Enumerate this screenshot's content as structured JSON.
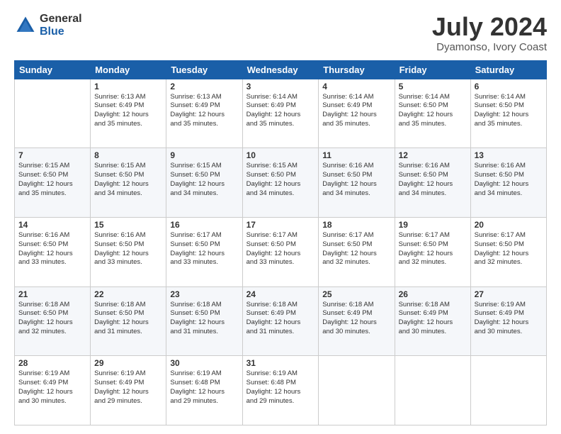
{
  "logo": {
    "general": "General",
    "blue": "Blue"
  },
  "header": {
    "title": "July 2024",
    "subtitle": "Dyamonso, Ivory Coast"
  },
  "weekdays": [
    "Sunday",
    "Monday",
    "Tuesday",
    "Wednesday",
    "Thursday",
    "Friday",
    "Saturday"
  ],
  "weeks": [
    [
      {
        "day": "",
        "detail": ""
      },
      {
        "day": "1",
        "detail": "Sunrise: 6:13 AM\nSunset: 6:49 PM\nDaylight: 12 hours\nand 35 minutes."
      },
      {
        "day": "2",
        "detail": "Sunrise: 6:13 AM\nSunset: 6:49 PM\nDaylight: 12 hours\nand 35 minutes."
      },
      {
        "day": "3",
        "detail": "Sunrise: 6:14 AM\nSunset: 6:49 PM\nDaylight: 12 hours\nand 35 minutes."
      },
      {
        "day": "4",
        "detail": "Sunrise: 6:14 AM\nSunset: 6:49 PM\nDaylight: 12 hours\nand 35 minutes."
      },
      {
        "day": "5",
        "detail": "Sunrise: 6:14 AM\nSunset: 6:50 PM\nDaylight: 12 hours\nand 35 minutes."
      },
      {
        "day": "6",
        "detail": "Sunrise: 6:14 AM\nSunset: 6:50 PM\nDaylight: 12 hours\nand 35 minutes."
      }
    ],
    [
      {
        "day": "7",
        "detail": "Sunrise: 6:15 AM\nSunset: 6:50 PM\nDaylight: 12 hours\nand 35 minutes."
      },
      {
        "day": "8",
        "detail": "Sunrise: 6:15 AM\nSunset: 6:50 PM\nDaylight: 12 hours\nand 34 minutes."
      },
      {
        "day": "9",
        "detail": "Sunrise: 6:15 AM\nSunset: 6:50 PM\nDaylight: 12 hours\nand 34 minutes."
      },
      {
        "day": "10",
        "detail": "Sunrise: 6:15 AM\nSunset: 6:50 PM\nDaylight: 12 hours\nand 34 minutes."
      },
      {
        "day": "11",
        "detail": "Sunrise: 6:16 AM\nSunset: 6:50 PM\nDaylight: 12 hours\nand 34 minutes."
      },
      {
        "day": "12",
        "detail": "Sunrise: 6:16 AM\nSunset: 6:50 PM\nDaylight: 12 hours\nand 34 minutes."
      },
      {
        "day": "13",
        "detail": "Sunrise: 6:16 AM\nSunset: 6:50 PM\nDaylight: 12 hours\nand 34 minutes."
      }
    ],
    [
      {
        "day": "14",
        "detail": "Sunrise: 6:16 AM\nSunset: 6:50 PM\nDaylight: 12 hours\nand 33 minutes."
      },
      {
        "day": "15",
        "detail": "Sunrise: 6:16 AM\nSunset: 6:50 PM\nDaylight: 12 hours\nand 33 minutes."
      },
      {
        "day": "16",
        "detail": "Sunrise: 6:17 AM\nSunset: 6:50 PM\nDaylight: 12 hours\nand 33 minutes."
      },
      {
        "day": "17",
        "detail": "Sunrise: 6:17 AM\nSunset: 6:50 PM\nDaylight: 12 hours\nand 33 minutes."
      },
      {
        "day": "18",
        "detail": "Sunrise: 6:17 AM\nSunset: 6:50 PM\nDaylight: 12 hours\nand 32 minutes."
      },
      {
        "day": "19",
        "detail": "Sunrise: 6:17 AM\nSunset: 6:50 PM\nDaylight: 12 hours\nand 32 minutes."
      },
      {
        "day": "20",
        "detail": "Sunrise: 6:17 AM\nSunset: 6:50 PM\nDaylight: 12 hours\nand 32 minutes."
      }
    ],
    [
      {
        "day": "21",
        "detail": "Sunrise: 6:18 AM\nSunset: 6:50 PM\nDaylight: 12 hours\nand 32 minutes."
      },
      {
        "day": "22",
        "detail": "Sunrise: 6:18 AM\nSunset: 6:50 PM\nDaylight: 12 hours\nand 31 minutes."
      },
      {
        "day": "23",
        "detail": "Sunrise: 6:18 AM\nSunset: 6:50 PM\nDaylight: 12 hours\nand 31 minutes."
      },
      {
        "day": "24",
        "detail": "Sunrise: 6:18 AM\nSunset: 6:49 PM\nDaylight: 12 hours\nand 31 minutes."
      },
      {
        "day": "25",
        "detail": "Sunrise: 6:18 AM\nSunset: 6:49 PM\nDaylight: 12 hours\nand 30 minutes."
      },
      {
        "day": "26",
        "detail": "Sunrise: 6:18 AM\nSunset: 6:49 PM\nDaylight: 12 hours\nand 30 minutes."
      },
      {
        "day": "27",
        "detail": "Sunrise: 6:19 AM\nSunset: 6:49 PM\nDaylight: 12 hours\nand 30 minutes."
      }
    ],
    [
      {
        "day": "28",
        "detail": "Sunrise: 6:19 AM\nSunset: 6:49 PM\nDaylight: 12 hours\nand 30 minutes."
      },
      {
        "day": "29",
        "detail": "Sunrise: 6:19 AM\nSunset: 6:49 PM\nDaylight: 12 hours\nand 29 minutes."
      },
      {
        "day": "30",
        "detail": "Sunrise: 6:19 AM\nSunset: 6:48 PM\nDaylight: 12 hours\nand 29 minutes."
      },
      {
        "day": "31",
        "detail": "Sunrise: 6:19 AM\nSunset: 6:48 PM\nDaylight: 12 hours\nand 29 minutes."
      },
      {
        "day": "",
        "detail": ""
      },
      {
        "day": "",
        "detail": ""
      },
      {
        "day": "",
        "detail": ""
      }
    ]
  ]
}
